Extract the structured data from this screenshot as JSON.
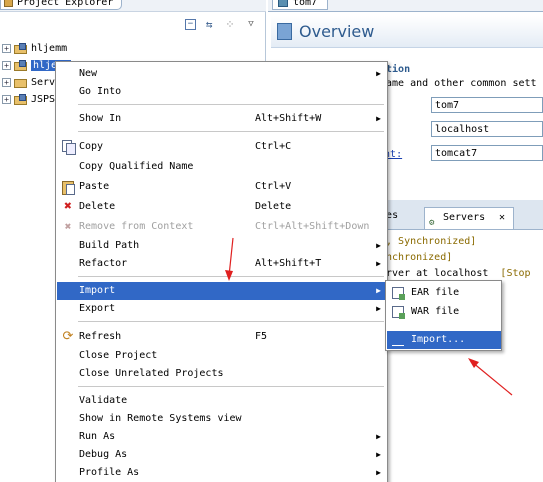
{
  "explorer": {
    "tab_title": "Project Explorer",
    "tree": [
      {
        "label": "hljemm",
        "selected": false
      },
      {
        "label": "hljemm",
        "selected": true
      },
      {
        "label": "Servers",
        "selected": false
      },
      {
        "label": "JSPS",
        "selected": false
      }
    ]
  },
  "editor": {
    "tab_title": "tom7",
    "overview_title": "Overview",
    "section_title": "ation",
    "section_desc": "name and other common sett",
    "fields": [
      "tom7",
      "localhost",
      "tomcat7"
    ],
    "runtime_link": "ment:"
  },
  "servers_view": {
    "tab_properties": "rties",
    "tab_servers": "Servers",
    "tab_close": "✕",
    "lines": [
      "d, Synchronized]",
      "ynchronized]",
      "erver at localhost"
    ],
    "stop_text": "[Stop"
  },
  "context_menu": {
    "items": [
      {
        "label": "New",
        "shortcut": "",
        "submenu": true
      },
      {
        "label": "Go Into",
        "shortcut": ""
      },
      {
        "label": "Show In",
        "shortcut": "Alt+Shift+W",
        "submenu": true
      },
      {
        "label": "Copy",
        "shortcut": "Ctrl+C",
        "icon": "copy-icon"
      },
      {
        "label": "Copy Qualified Name",
        "shortcut": ""
      },
      {
        "label": "Paste",
        "shortcut": "Ctrl+V",
        "icon": "paste-icon"
      },
      {
        "label": "Delete",
        "shortcut": "Delete",
        "icon": "delete-icon"
      },
      {
        "label": "Remove from Context",
        "shortcut": "Ctrl+Alt+Shift+Down",
        "disabled": true,
        "icon": "remove-context-icon"
      },
      {
        "label": "Build Path",
        "shortcut": "",
        "submenu": true
      },
      {
        "label": "Refactor",
        "shortcut": "Alt+Shift+T",
        "submenu": true
      },
      {
        "label": "Import",
        "shortcut": "",
        "submenu": true,
        "highlighted": true
      },
      {
        "label": "Export",
        "shortcut": "",
        "submenu": true
      },
      {
        "label": "Refresh",
        "shortcut": "F5",
        "icon": "refresh-icon"
      },
      {
        "label": "Close Project",
        "shortcut": ""
      },
      {
        "label": "Close Unrelated Projects",
        "shortcut": ""
      },
      {
        "label": "Validate",
        "shortcut": ""
      },
      {
        "label": "Show in Remote Systems view",
        "shortcut": ""
      },
      {
        "label": "Run As",
        "shortcut": "",
        "submenu": true
      },
      {
        "label": "Debug As",
        "shortcut": "",
        "submenu": true
      },
      {
        "label": "Profile As",
        "shortcut": "",
        "submenu": true
      }
    ]
  },
  "import_submenu": {
    "items": [
      {
        "label": "EAR file"
      },
      {
        "label": "WAR file"
      },
      {
        "label": "Import...",
        "highlighted": true
      }
    ]
  },
  "colors": {
    "selection": "#3168c6",
    "annotation_arrow": "#e02020",
    "title_blue": "#2e5b8e"
  }
}
